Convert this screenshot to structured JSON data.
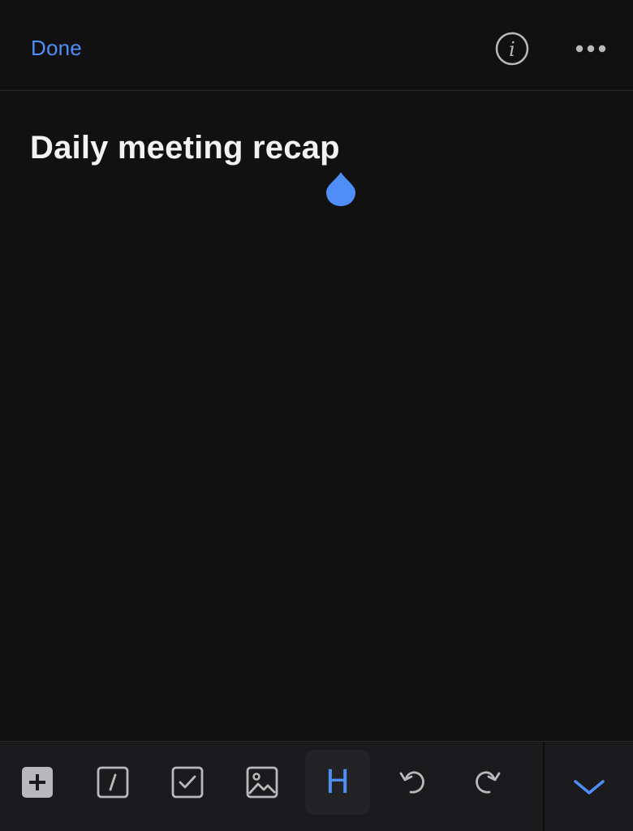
{
  "header": {
    "done_label": "Done",
    "info_icon": "info-icon",
    "more_icon": "more-horizontal-icon"
  },
  "note": {
    "title": "Daily meeting recap",
    "body": ""
  },
  "toolbar": {
    "items": [
      {
        "icon": "add-block-icon"
      },
      {
        "icon": "slash-command-icon"
      },
      {
        "icon": "checklist-icon"
      },
      {
        "icon": "image-icon"
      },
      {
        "icon": "heading-icon",
        "label": "H",
        "active": true
      },
      {
        "icon": "undo-icon"
      },
      {
        "icon": "redo-icon"
      }
    ],
    "collapse_icon": "chevron-down-icon"
  },
  "colors": {
    "accent": "#4f8ef7",
    "background": "#111112",
    "toolbar_background": "#1b1b1d",
    "text": "#f2f2f2",
    "icon": "#b9b9bb"
  }
}
